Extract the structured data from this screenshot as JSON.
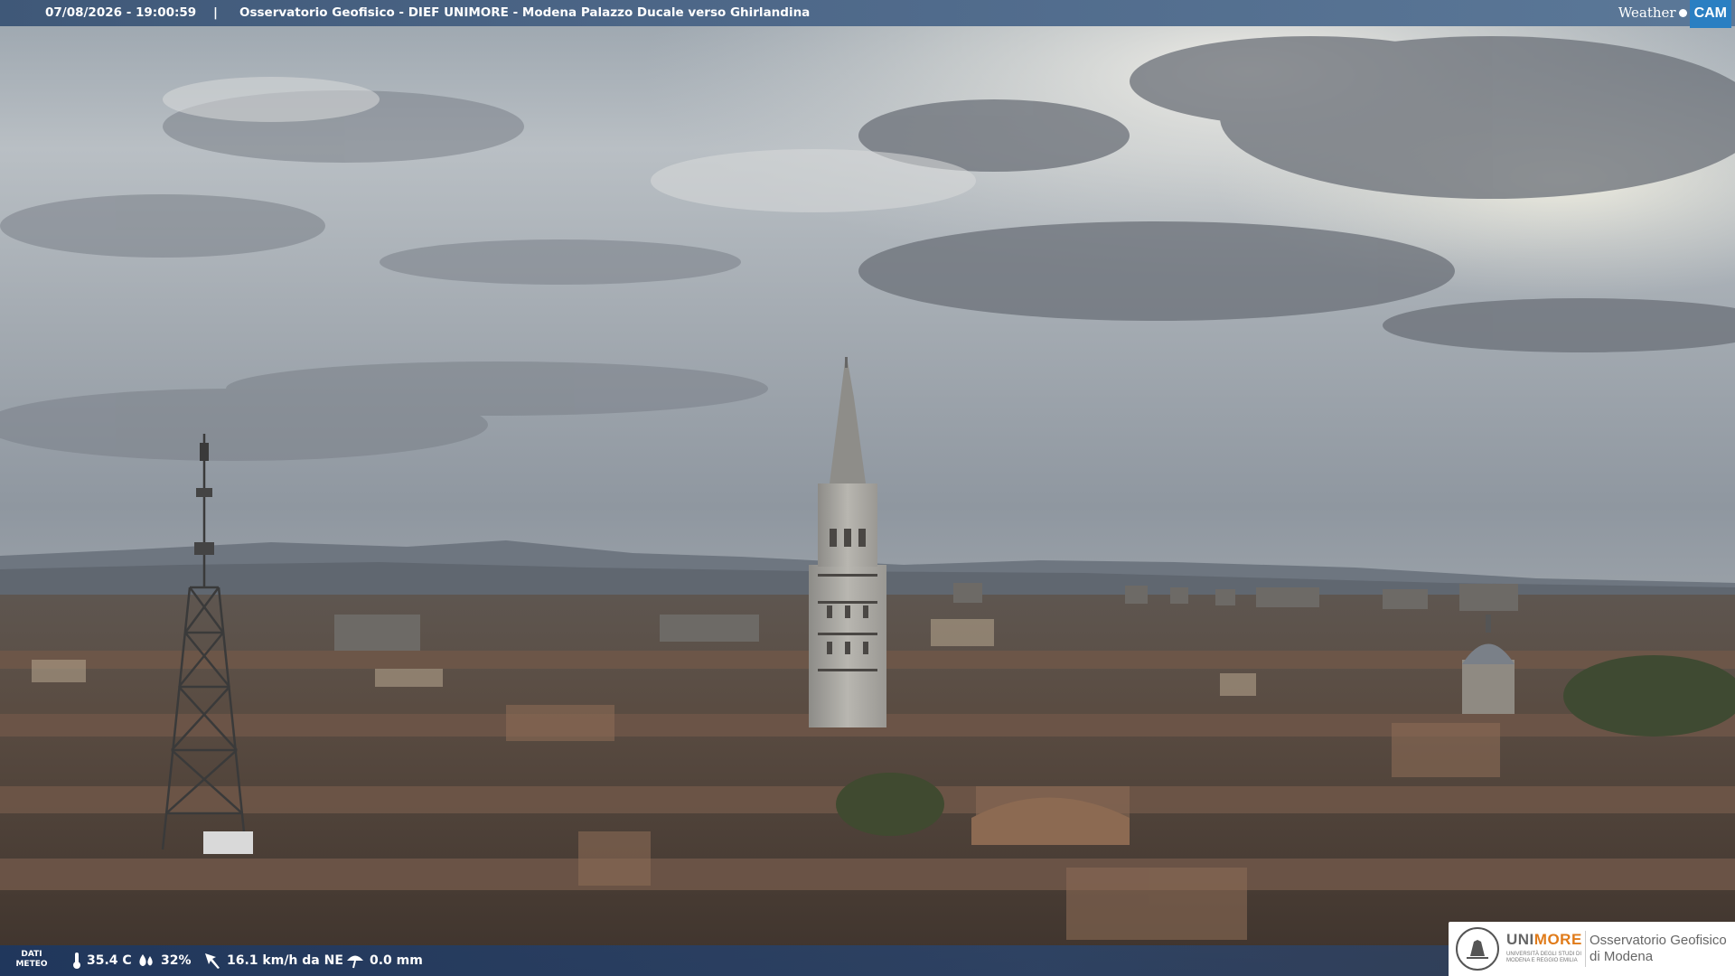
{
  "overlay": {
    "datetime": "07/08/2026 - 19:00:59",
    "separator": "|",
    "location": "Osservatorio Geofisico - DIEF UNIMORE - Modena Palazzo Ducale verso Ghirlandina"
  },
  "brand": {
    "weather": "Weather",
    "cam": "CAM"
  },
  "meteo": {
    "label_line1": "DATI",
    "label_line2": "METEO",
    "temperature": "35.4 C",
    "humidity": "32%",
    "wind": "16.1 km/h da NE",
    "rain": "0.0 mm"
  },
  "logo": {
    "uni": "UNI",
    "more": "MORE",
    "subtitle": "UNIVERSITÀ DEGLI STUDI DI MODENA E REGGIO EMILIA",
    "observatory_line1": "Osservatorio Geofisico",
    "observatory_line2": "di Modena"
  },
  "colors": {
    "topbar": "#4d6788",
    "brand_cam": "#2a7fc2",
    "unimore_orange": "#e07b1a"
  }
}
